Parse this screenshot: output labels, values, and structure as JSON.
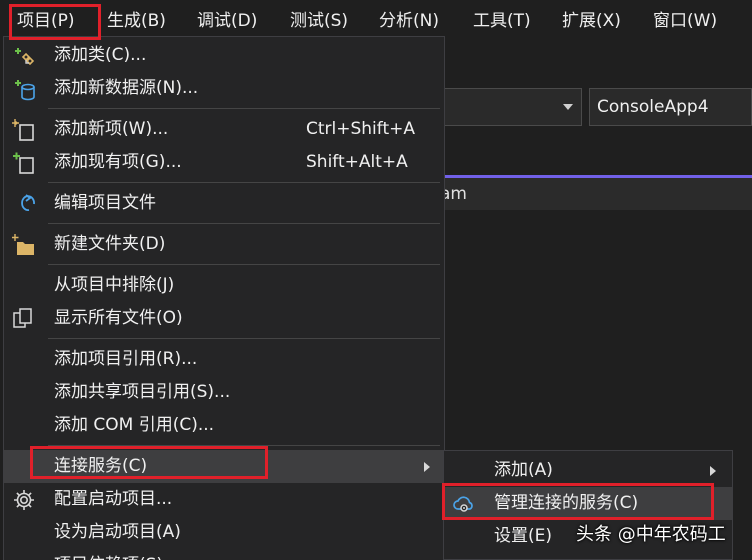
{
  "menubar": {
    "items": [
      "项目(P)",
      "生成(B)",
      "调试(D)",
      "测试(S)",
      "分析(N)",
      "工具(T)",
      "扩展(X)",
      "窗口(W)"
    ]
  },
  "toolbar": {
    "config_combo_value": "",
    "project_combo_value": "ConsoleApp4"
  },
  "editor": {
    "tab_fragment": "am"
  },
  "project_menu": {
    "items": [
      {
        "label": "添加类(C)...",
        "shortcut": "",
        "icon": "add-class-icon"
      },
      {
        "label": "添加新数据源(N)...",
        "shortcut": "",
        "icon": "add-datasource-icon"
      },
      {
        "label": "添加新项(W)...",
        "shortcut": "Ctrl+Shift+A",
        "icon": "add-new-item-icon"
      },
      {
        "label": "添加现有项(G)...",
        "shortcut": "Shift+Alt+A",
        "icon": "add-existing-item-icon"
      },
      {
        "label": "编辑项目文件",
        "shortcut": "",
        "icon": "edit-project-file-icon"
      },
      {
        "label": "新建文件夹(D)",
        "shortcut": "",
        "icon": "new-folder-icon"
      },
      {
        "label": "从项目中排除(J)",
        "shortcut": "",
        "icon": ""
      },
      {
        "label": "显示所有文件(O)",
        "shortcut": "",
        "icon": "show-all-files-icon"
      },
      {
        "label": "添加项目引用(R)...",
        "shortcut": "",
        "icon": ""
      },
      {
        "label": "添加共享项目引用(S)...",
        "shortcut": "",
        "icon": ""
      },
      {
        "label": "添加 COM 引用(C)...",
        "shortcut": "",
        "icon": ""
      },
      {
        "label": "连接服务(C)",
        "shortcut": "",
        "icon": "",
        "has_submenu": true,
        "active": true
      },
      {
        "label": "配置启动项目...",
        "shortcut": "",
        "icon": "gear-icon"
      },
      {
        "label": "设为启动项目(A)",
        "shortcut": "",
        "icon": ""
      },
      {
        "label": "项目依赖项(S)...",
        "shortcut": "",
        "icon": ""
      }
    ]
  },
  "connected_services_submenu": {
    "items": [
      {
        "label": "添加(A)",
        "icon": "",
        "has_submenu": true
      },
      {
        "label": "管理连接的服务(C)",
        "icon": "cloud-gear-icon",
        "active": true
      },
      {
        "label": "设置(E)",
        "icon": ""
      }
    ]
  },
  "watermark": "头条 @中年农码工",
  "colors": {
    "background": "#1f1f1f",
    "menu_background": "#252526",
    "highlight_row": "#3e3e40",
    "annotation_red": "#e0202a",
    "accent_purple": "#7160e8",
    "icon_blue": "#4ba3e8",
    "icon_green": "#6cc04a",
    "folder_yellow": "#dcb567"
  }
}
